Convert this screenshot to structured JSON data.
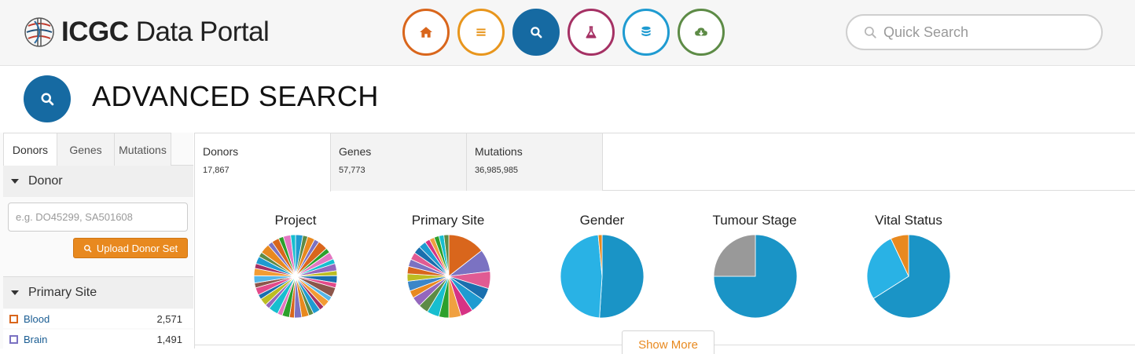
{
  "header": {
    "logo_bold": "ICGC",
    "logo_rest": "Data Portal",
    "nav": [
      {
        "name": "home-icon",
        "color": "#d9661c"
      },
      {
        "name": "list-icon",
        "color": "#e8961d"
      },
      {
        "name": "search-icon",
        "color": "#166aa2",
        "active": true
      },
      {
        "name": "flask-icon",
        "color": "#a53164"
      },
      {
        "name": "database-icon",
        "color": "#1f9bd1"
      },
      {
        "name": "cloud-download-icon",
        "color": "#5d8b46"
      }
    ],
    "quick_search_placeholder": "Quick Search"
  },
  "page": {
    "title": "ADVANCED SEARCH",
    "accent": "#166aa2"
  },
  "sidebar": {
    "tabs": [
      {
        "label": "Donors",
        "active": true
      },
      {
        "label": "Genes",
        "active": false
      },
      {
        "label": "Mutations",
        "active": false
      }
    ],
    "donor_facet": {
      "title": "Donor",
      "input_placeholder": "e.g. DO45299, SA501608",
      "upload_label": "Upload Donor Set"
    },
    "primary_site_facet": {
      "title": "Primary Site",
      "items": [
        {
          "label": "Blood",
          "count": "2,571",
          "color": "#d9661c"
        },
        {
          "label": "Brain",
          "count": "1,491",
          "color": "#7b72c2"
        }
      ]
    }
  },
  "results": {
    "tabs": [
      {
        "label": "Donors",
        "count": "17,867",
        "active": true
      },
      {
        "label": "Genes",
        "count": "57,773",
        "active": false
      },
      {
        "label": "Mutations",
        "count": "36,985,985",
        "active": false
      }
    ],
    "charts": [
      {
        "title": "Project"
      },
      {
        "title": "Primary Site"
      },
      {
        "title": "Gender"
      },
      {
        "title": "Tumour Stage"
      },
      {
        "title": "Vital Status"
      }
    ],
    "show_more_label": "Show More"
  },
  "chart_data": [
    {
      "type": "pie",
      "title": "Project",
      "values": [
        3,
        2,
        3,
        2,
        4,
        2,
        3,
        2,
        3,
        2,
        3,
        2,
        4,
        2,
        3,
        2,
        3,
        2,
        3,
        3,
        2,
        3,
        2,
        4,
        2,
        3,
        2,
        3,
        2,
        3,
        3,
        2,
        3,
        2,
        4,
        2,
        3,
        2,
        3,
        2
      ]
    },
    {
      "type": "pie",
      "title": "Primary Site",
      "values": [
        15,
        9,
        7,
        5,
        6,
        5,
        5,
        4,
        5,
        4,
        4,
        3,
        4,
        3,
        3,
        3,
        3,
        3,
        3,
        2,
        2,
        2,
        2,
        2
      ]
    },
    {
      "type": "pie",
      "title": "Gender",
      "values": [
        51,
        47.5,
        1.5
      ]
    },
    {
      "type": "pie",
      "title": "Tumour Stage",
      "values": [
        75,
        25
      ]
    },
    {
      "type": "pie",
      "title": "Vital Status",
      "values": [
        66,
        27,
        7
      ]
    }
  ],
  "palettes": {
    "project": [
      "#1f9bd1",
      "#5d8b46",
      "#e8891f",
      "#7b72c2",
      "#d9661c",
      "#2ca02c",
      "#e377c2",
      "#17becf",
      "#9467bd",
      "#bcbd22",
      "#1a6fae",
      "#e34a8a",
      "#8c564b",
      "#55b6e8",
      "#f39c34",
      "#a53164"
    ],
    "primary_site": [
      "#d9661c",
      "#7b72c2",
      "#e15b93",
      "#1a6fae",
      "#1f9bd1",
      "#d63384",
      "#f0a040",
      "#2ca02c",
      "#17becf",
      "#5d8b46",
      "#9467bd",
      "#e8891f",
      "#3a86c8",
      "#bcbd22"
    ],
    "gender": [
      "#1a94c6",
      "#29b2e5",
      "#e8891f"
    ],
    "tumour_stage": [
      "#1a94c6",
      "#999999"
    ],
    "vital_status": [
      "#1a94c6",
      "#29b2e5",
      "#e8891f"
    ]
  }
}
